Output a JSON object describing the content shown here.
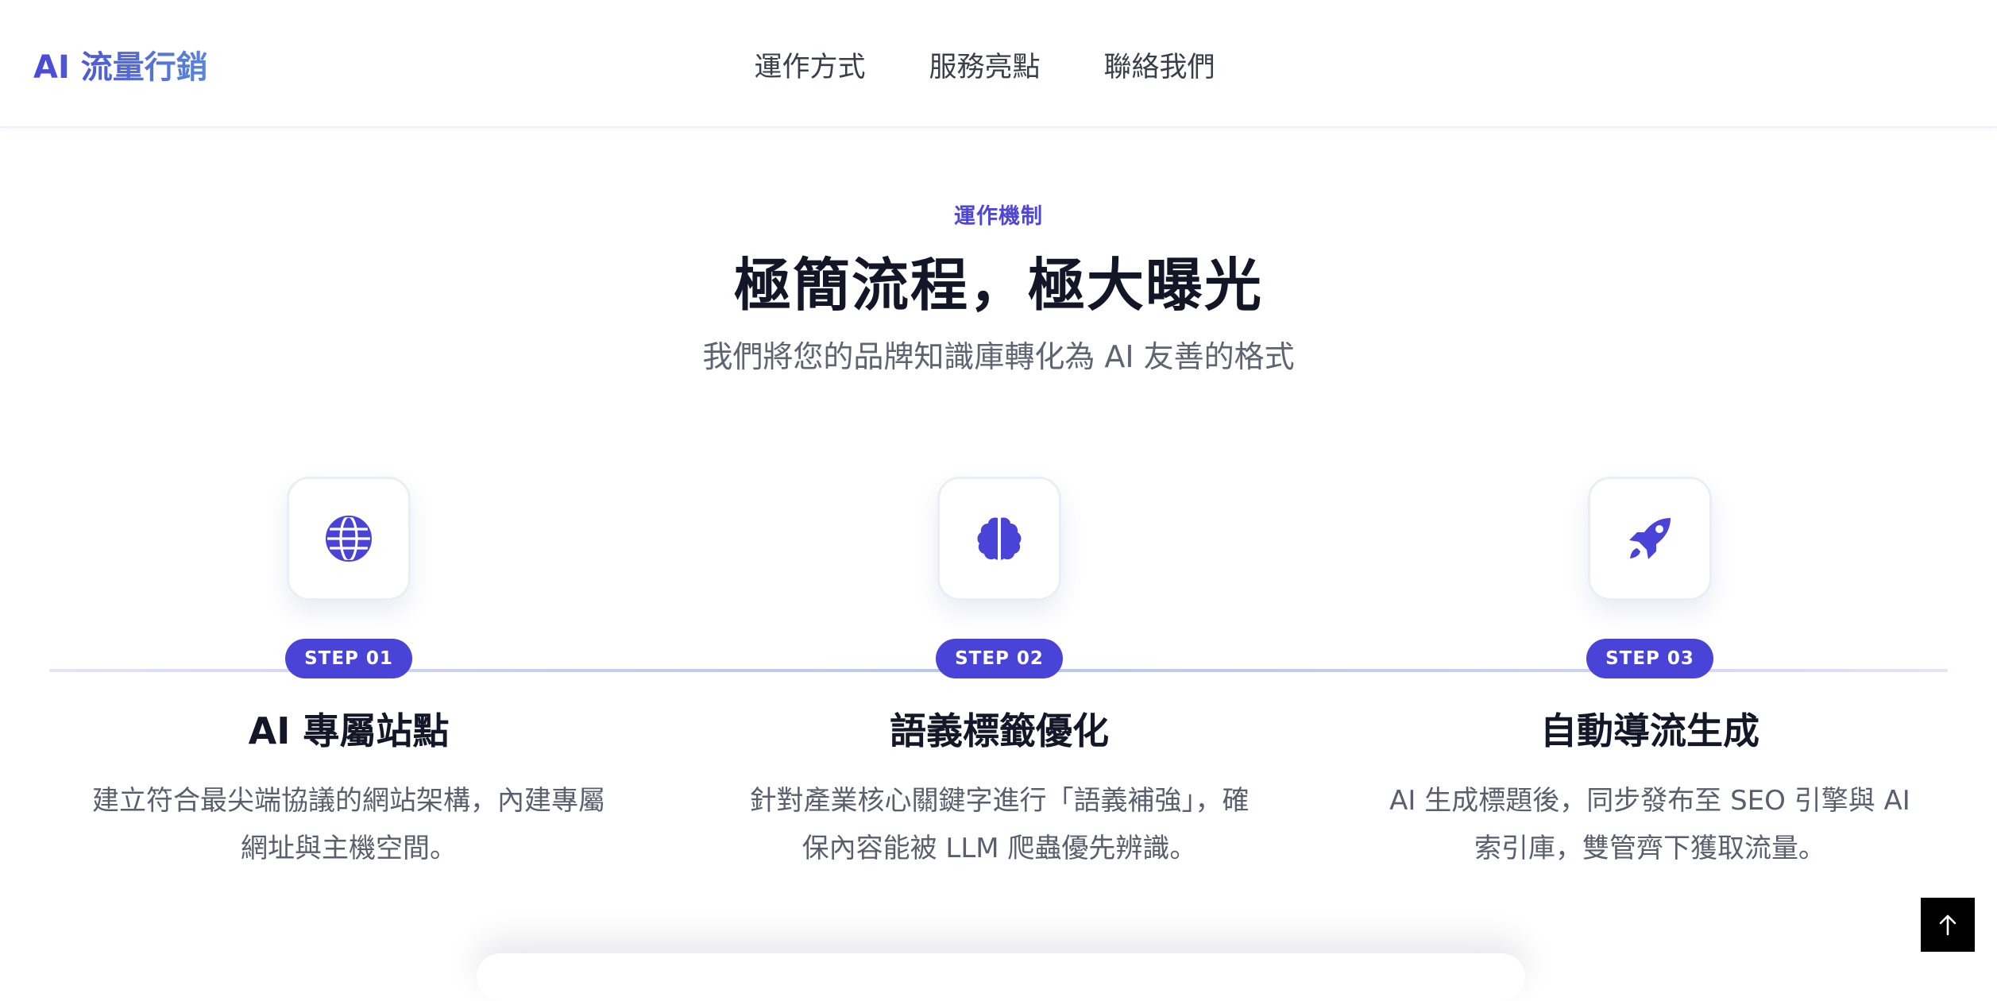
{
  "nav": {
    "brand": "AI 流量行銷",
    "links": [
      {
        "label": "運作方式"
      },
      {
        "label": "服務亮點"
      },
      {
        "label": "聯絡我們"
      }
    ]
  },
  "section": {
    "eyebrow": "運作機制",
    "title": "極簡流程，極大曝光",
    "subtitle": "我們將您的品牌知識庫轉化為 AI 友善的格式"
  },
  "steps": [
    {
      "icon": "globe-icon",
      "badge": "STEP 01",
      "title": "AI 專屬站點",
      "desc_line1": "建立符合最尖端協議的網站架構，內建專屬",
      "desc_line2": "網址與主機空間。"
    },
    {
      "icon": "brain-icon",
      "badge": "STEP 02",
      "title": "語義標籤優化",
      "desc_line1": "針對產業核心關鍵字進行「語義補強」，確",
      "desc_line2": "保內容能被 LLM 爬蟲優先辨識。"
    },
    {
      "icon": "rocket-icon",
      "badge": "STEP 03",
      "title": "自動導流生成",
      "desc_line1": "AI 生成標題後，同步發布至 SEO 引擎與 AI",
      "desc_line2": "索引庫，雙管齊下獲取流量。"
    }
  ],
  "back_to_top": {
    "icon": "arrow-up-icon"
  },
  "colors": {
    "accent": "#4a43d8",
    "brand_gradient_start": "#4b48d8",
    "brand_gradient_end": "#5a86d8",
    "text_dark": "#131727",
    "text_muted": "#5a5f6e"
  }
}
